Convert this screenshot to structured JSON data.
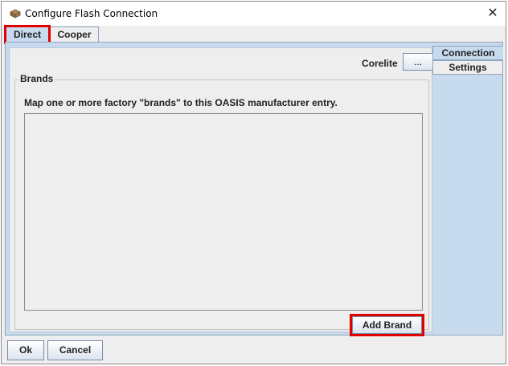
{
  "window": {
    "title": "Configure Flash Connection",
    "icon": "app-icon",
    "close_glyph": "✕"
  },
  "tabs": [
    {
      "label": "Direct",
      "selected": true,
      "highlighted": true
    },
    {
      "label": "Cooper",
      "selected": false
    }
  ],
  "panel": {
    "corelite_label": "Corelite",
    "ellipsis_label": "...",
    "group_title": "Brands",
    "instruction": "Map one or more factory \"brands\" to this OASIS manufacturer entry.",
    "add_brand_label": "Add Brand",
    "add_brand_highlighted": true
  },
  "side_tabs": [
    {
      "label": "Connection",
      "selected": true
    },
    {
      "label": "Settings",
      "selected": false
    }
  ],
  "buttons": {
    "ok_label": "Ok",
    "cancel_label": "Cancel"
  },
  "colors": {
    "highlight": "#e00000",
    "tab_selected": "#c8daee",
    "panel_bg": "#eeeeee"
  }
}
